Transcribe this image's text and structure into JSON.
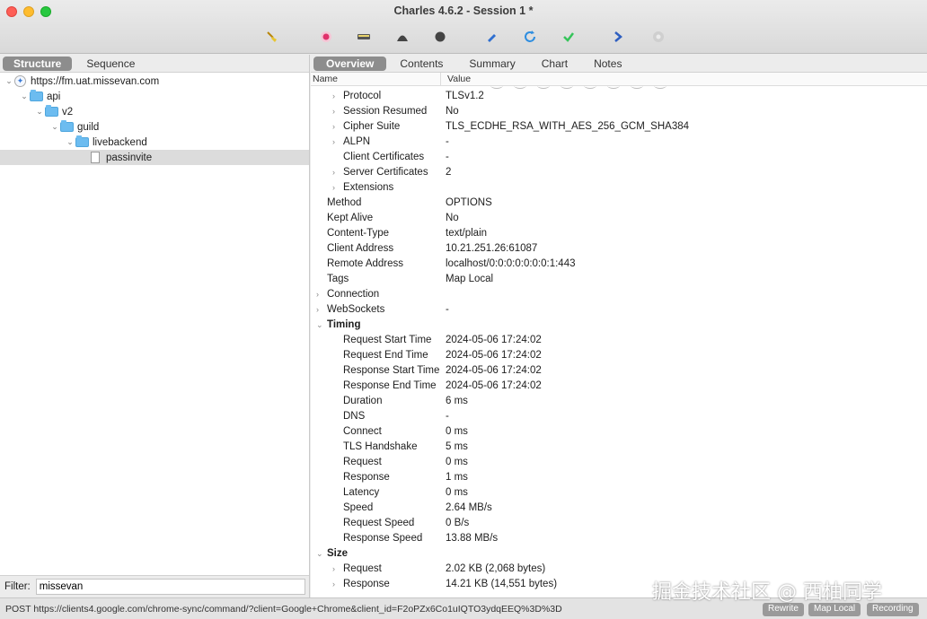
{
  "window": {
    "title": "Charles 4.6.2 - Session 1 *"
  },
  "toolbar": {
    "icons": [
      "broom-icon",
      "record-icon",
      "throttle-icon",
      "breakpoint-icon",
      "stop-icon",
      "compose-icon",
      "refresh-icon",
      "validate-icon",
      "forward-icon",
      "settings-icon"
    ],
    "colors": {
      "record": "#e0316b",
      "refresh": "#2f8ee0",
      "validate": "#35c45a",
      "compose": "#2f6fd0",
      "forward": "#2f5fc0"
    }
  },
  "left": {
    "tabs": [
      {
        "label": "Structure",
        "active": true
      },
      {
        "label": "Sequence",
        "active": false
      }
    ],
    "tree": [
      {
        "label": "https://fm.uat.missevan.com",
        "kind": "host",
        "indent": 0,
        "expanded": true
      },
      {
        "label": "api",
        "kind": "folder",
        "indent": 1,
        "expanded": true
      },
      {
        "label": "v2",
        "kind": "folder",
        "indent": 2,
        "expanded": true
      },
      {
        "label": "guild",
        "kind": "folder",
        "indent": 3,
        "expanded": true
      },
      {
        "label": "livebackend",
        "kind": "folder",
        "indent": 4,
        "expanded": true
      },
      {
        "label": "passinvite",
        "kind": "file",
        "indent": 5,
        "selected": true
      }
    ],
    "filter": {
      "label": "Filter:",
      "value": "missevan"
    }
  },
  "right": {
    "tabs": [
      {
        "label": "Overview",
        "active": true
      },
      {
        "label": "Contents",
        "active": false
      },
      {
        "label": "Summary",
        "active": false
      },
      {
        "label": "Chart",
        "active": false
      },
      {
        "label": "Notes",
        "active": false
      }
    ],
    "columns": {
      "name": "Name",
      "value": "Value"
    },
    "rows": [
      {
        "name": "Protocol",
        "value": "TLSv1.2",
        "level": 2,
        "disclosure": "collapsed"
      },
      {
        "name": "Session Resumed",
        "value": "No",
        "level": 2,
        "disclosure": "collapsed"
      },
      {
        "name": "Cipher Suite",
        "value": "TLS_ECDHE_RSA_WITH_AES_256_GCM_SHA384",
        "level": 2,
        "disclosure": "collapsed"
      },
      {
        "name": "ALPN",
        "value": "-",
        "level": 2,
        "disclosure": "collapsed"
      },
      {
        "name": "Client Certificates",
        "value": "-",
        "level": 2,
        "disclosure": "none"
      },
      {
        "name": "Server Certificates",
        "value": "2",
        "level": 2,
        "disclosure": "collapsed"
      },
      {
        "name": "Extensions",
        "value": "",
        "level": 2,
        "disclosure": "collapsed"
      },
      {
        "name": "Method",
        "value": "OPTIONS",
        "level": 1,
        "disclosure": "none"
      },
      {
        "name": "Kept Alive",
        "value": "No",
        "level": 1,
        "disclosure": "none"
      },
      {
        "name": "Content-Type",
        "value": "text/plain",
        "level": 1,
        "disclosure": "none"
      },
      {
        "name": "Client Address",
        "value": "10.21.251.26:61087",
        "level": 1,
        "disclosure": "none"
      },
      {
        "name": "Remote Address",
        "value": "localhost/0:0:0:0:0:0:0:1:443",
        "level": 1,
        "disclosure": "none"
      },
      {
        "name": "Tags",
        "value": "Map Local",
        "level": 1,
        "disclosure": "none"
      },
      {
        "name": "Connection",
        "value": "",
        "level": 1,
        "disclosure": "collapsed"
      },
      {
        "name": "WebSockets",
        "value": "-",
        "level": 1,
        "disclosure": "collapsed"
      },
      {
        "name": "Timing",
        "value": "",
        "level": 1,
        "disclosure": "expanded",
        "section": true
      },
      {
        "name": "Request Start Time",
        "value": "2024-05-06 17:24:02",
        "level": 2,
        "disclosure": "none"
      },
      {
        "name": "Request End Time",
        "value": "2024-05-06 17:24:02",
        "level": 2,
        "disclosure": "none"
      },
      {
        "name": "Response Start Time",
        "value": "2024-05-06 17:24:02",
        "level": 2,
        "disclosure": "none"
      },
      {
        "name": "Response End Time",
        "value": "2024-05-06 17:24:02",
        "level": 2,
        "disclosure": "none"
      },
      {
        "name": "Duration",
        "value": "6 ms",
        "level": 2,
        "disclosure": "none"
      },
      {
        "name": "DNS",
        "value": "-",
        "level": 2,
        "disclosure": "none"
      },
      {
        "name": "Connect",
        "value": "0 ms",
        "level": 2,
        "disclosure": "none"
      },
      {
        "name": "TLS Handshake",
        "value": "5 ms",
        "level": 2,
        "disclosure": "none"
      },
      {
        "name": "Request",
        "value": "0 ms",
        "level": 2,
        "disclosure": "none"
      },
      {
        "name": "Response",
        "value": "1 ms",
        "level": 2,
        "disclosure": "none"
      },
      {
        "name": "Latency",
        "value": "0 ms",
        "level": 2,
        "disclosure": "none"
      },
      {
        "name": "Speed",
        "value": "2.64 MB/s",
        "level": 2,
        "disclosure": "none"
      },
      {
        "name": "Request Speed",
        "value": "0 B/s",
        "level": 2,
        "disclosure": "none"
      },
      {
        "name": "Response Speed",
        "value": "13.88 MB/s",
        "level": 2,
        "disclosure": "none"
      },
      {
        "name": "Size",
        "value": "",
        "level": 1,
        "disclosure": "expanded",
        "section": true
      },
      {
        "name": "Request",
        "value": "2.02 KB (2,068 bytes)",
        "level": 2,
        "disclosure": "collapsed"
      },
      {
        "name": "Response",
        "value": "14.21 KB (14,551 bytes)",
        "level": 2,
        "disclosure": "collapsed"
      }
    ]
  },
  "status": {
    "url": "POST https://clients4.google.com/chrome-sync/command/?client=Google+Chrome&client_id=F2oPZx6Co1uIQTO3ydqEEQ%3D%3D",
    "buttons": [
      "Rewrite",
      "Map Local",
      "Recording"
    ]
  },
  "watermark": "掘金技术社区 @ 西柚同学"
}
